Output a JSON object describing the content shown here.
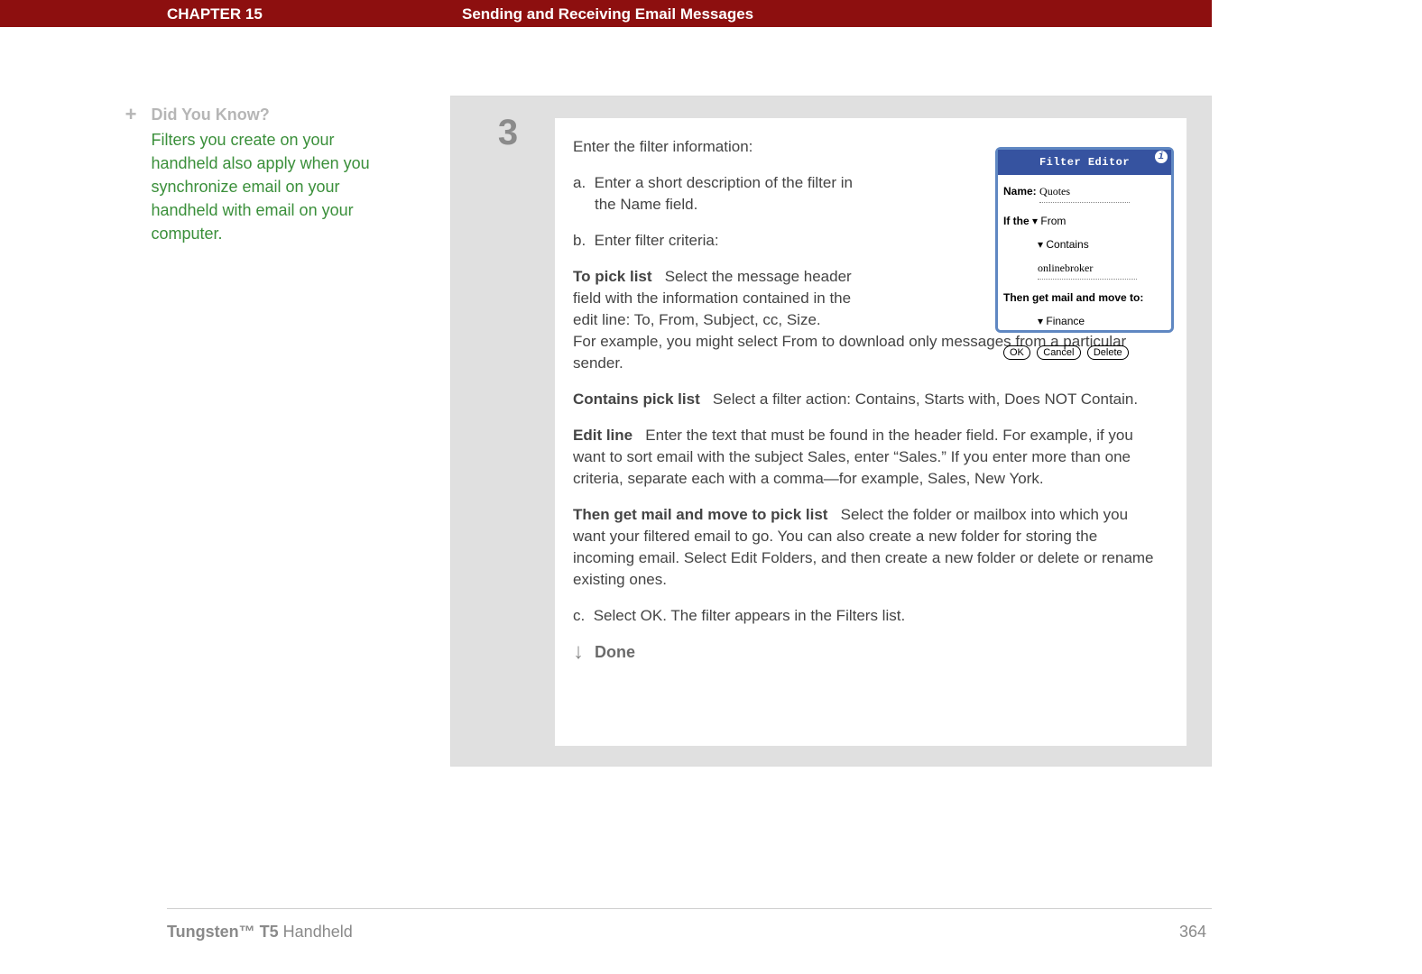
{
  "banner": {
    "chapter": "CHAPTER 15",
    "title": "Sending and Receiving Email Messages"
  },
  "sidebar": {
    "icon": "+",
    "heading": "Did You Know?",
    "body": "Filters you create on your handheld also apply when you synchronize email on your handheld with email on your computer."
  },
  "step": {
    "number": "3",
    "intro": "Enter the filter information:",
    "a_label": "a.",
    "a_text": "Enter a short description of the filter in the Name field.",
    "b_label": "b.",
    "b_text": "Enter filter criteria:",
    "to_pick_label": "To pick list",
    "to_pick_text1": "Select the message header field with the information contained in the edit line: To, From, Subject, cc, Size.",
    "to_pick_text2": "For example, you might select From to download only messages from a particular sender.",
    "contains_label": "Contains pick list",
    "contains_text": "Select a filter action: Contains, Starts with, Does NOT Contain.",
    "edit_label": "Edit line",
    "edit_text": "Enter the text that must be found in the header field. For example, if you want to sort email with the subject Sales, enter “Sales.” If you enter more than one criteria, separate each with a comma—for example, Sales, New York.",
    "then_label": "Then get mail and move to pick list",
    "then_text": "Select the folder or mailbox into which you want your filtered email to go. You can also create a new folder for storing the incoming email. Select Edit Folders, and then create a new folder or delete or rename existing ones.",
    "c_label": "c.",
    "c_text": "Select OK. The filter appears in the Filters list.",
    "done": "Done"
  },
  "mock": {
    "title": "Filter Editor",
    "info": "i",
    "name_lbl": "Name:",
    "name_val": "Quotes",
    "if_lbl": "If the",
    "if_drop1": "From",
    "if_drop2": "Contains",
    "if_text": "onlinebroker",
    "then_lbl": "Then get mail and move to:",
    "then_drop": "Finance",
    "ok": "OK",
    "cancel": "Cancel",
    "delete": "Delete"
  },
  "footer": {
    "product_bold": "Tungsten™ T5",
    "product_rest": " Handheld",
    "page": "364"
  }
}
